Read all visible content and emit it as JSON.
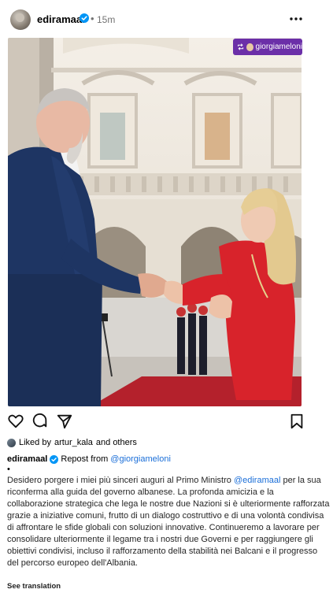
{
  "post": {
    "username": "ediramaal",
    "time_ago": "15m",
    "dot": "•"
  },
  "photo": {
    "repost_badge_user": "giorgiameloni"
  },
  "likes": {
    "prefix": "Liked by ",
    "user": "artur_kala",
    "suffix": " and others"
  },
  "caption": {
    "username": "ediramaal",
    "repost_label": "Repost from ",
    "repost_user": "@giorgiameloni",
    "bullet": "•",
    "text_part1": "Desidero porgere i miei più sinceri auguri al Primo Ministro ",
    "mention": "@ediramaal",
    "text_part2": " per la sua riconferma alla guida del governo albanese. La profonda amicizia e la collaborazione strategica che lega le nostre due Nazioni si è ulteriormente rafforzata grazie a iniziative comuni, frutto di un dialogo costruttivo e di una volontà condivisa di affrontare le sfide globali con soluzioni innovative. Continueremo a lavorare per consolidare ulteriormente il legame tra i nostri due Governi e per raggiungere gli obiettivi condivisi, incluso il rafforzamento della stabilità nei Balcani e il progresso del percorso europeo dell'Albania.",
    "see_translation": "See translation"
  },
  "colors": {
    "verified": "#0095f6",
    "badge": "#6b2fa8",
    "link": "#1a6ed8",
    "blazer_blue": "#1e3563",
    "blazer_red": "#d8232b"
  },
  "icons": [
    "verified-icon",
    "more-icon",
    "repost-icon",
    "heart-icon",
    "comment-icon",
    "share-icon",
    "bookmark-icon"
  ]
}
